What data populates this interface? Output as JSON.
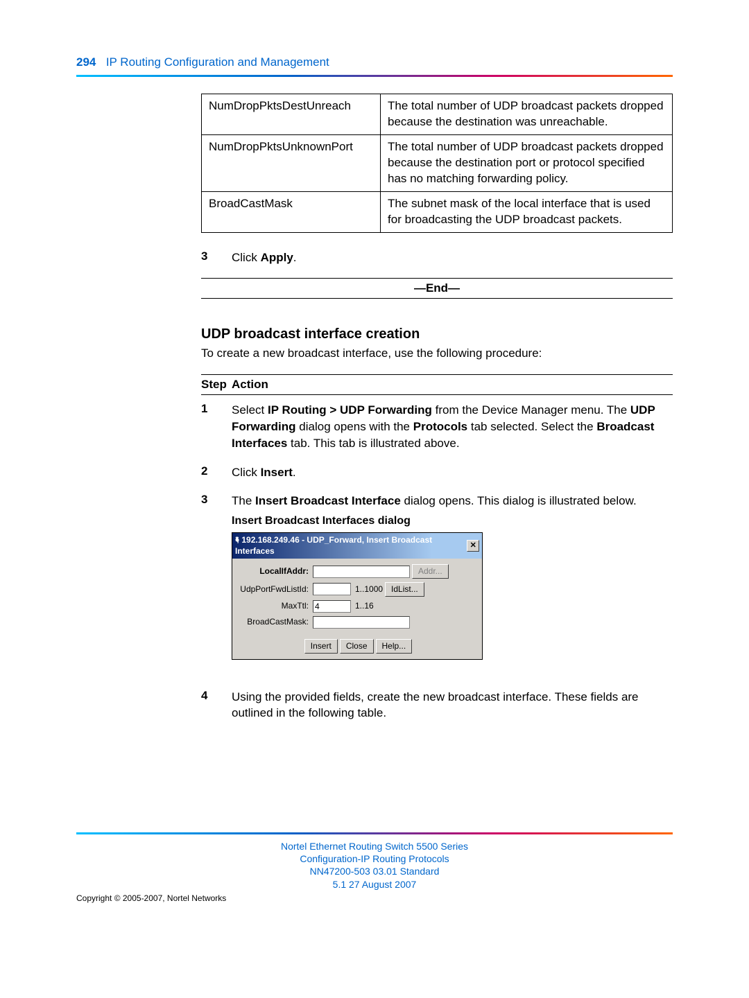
{
  "header": {
    "page_number": "294",
    "title": "IP Routing Configuration and Management"
  },
  "table": {
    "rows": [
      {
        "field": "NumDropPktsDestUnreach",
        "desc": "The total number of UDP broadcast packets dropped because the destination was unreachable."
      },
      {
        "field": "NumDropPktsUnknownPort",
        "desc": "The total number of UDP broadcast packets dropped because the destination port or protocol specified has no matching forwarding policy."
      },
      {
        "field": "BroadCastMask",
        "desc": "The subnet mask of the local interface that is used for broadcasting the UDP broadcast packets."
      }
    ]
  },
  "step3a": {
    "num": "3",
    "pre": "Click ",
    "bold": "Apply",
    "post": "."
  },
  "end_label": "—End—",
  "section": {
    "heading": "UDP broadcast interface creation",
    "intro": "To create a new broadcast interface, use the following procedure:"
  },
  "step_header": {
    "col1": "Step",
    "col2": "Action"
  },
  "steps": {
    "s1": {
      "num": "1",
      "t1": "Select ",
      "b1": "IP Routing > UDP Forwarding",
      "t2": " from the Device Manager menu. The ",
      "b2": "UDP Forwarding",
      "t3": " dialog opens with the ",
      "b3": "Protocols",
      "t4": " tab selected. Select the ",
      "b4": "Broadcast Interfaces",
      "t5": " tab. This tab is illustrated above."
    },
    "s2": {
      "num": "2",
      "pre": "Click ",
      "bold": "Insert",
      "post": "."
    },
    "s3": {
      "num": "3",
      "t1": "The ",
      "b1": "Insert Broadcast Interface",
      "t2": " dialog opens. This dialog is illustrated below."
    },
    "s4": {
      "num": "4",
      "text": "Using the provided fields, create the new broadcast interface. These fields are outlined in the following table."
    }
  },
  "figure": {
    "caption": "Insert Broadcast Interfaces dialog",
    "title": "192.168.249.46 - UDP_Forward, Insert Broadcast Interfaces",
    "labels": {
      "local": "LocalIfAddr:",
      "fwd": "UdpPortFwdListId:",
      "ttl": "MaxTtl:",
      "mask": "BroadCastMask:"
    },
    "values": {
      "ttl": "4"
    },
    "hints": {
      "fwd": "1..1000",
      "ttl": "1..16"
    },
    "buttons": {
      "addr": "Addr...",
      "idlist": "IdList...",
      "insert": "Insert",
      "close": "Close",
      "help": "Help..."
    }
  },
  "footer": {
    "l1": "Nortel Ethernet Routing Switch 5500 Series",
    "l2": "Configuration-IP Routing Protocols",
    "l3": "NN47200-503   03.01   Standard",
    "l4": "5.1   27 August 2007",
    "copyright": "Copyright © 2005-2007, Nortel Networks"
  }
}
